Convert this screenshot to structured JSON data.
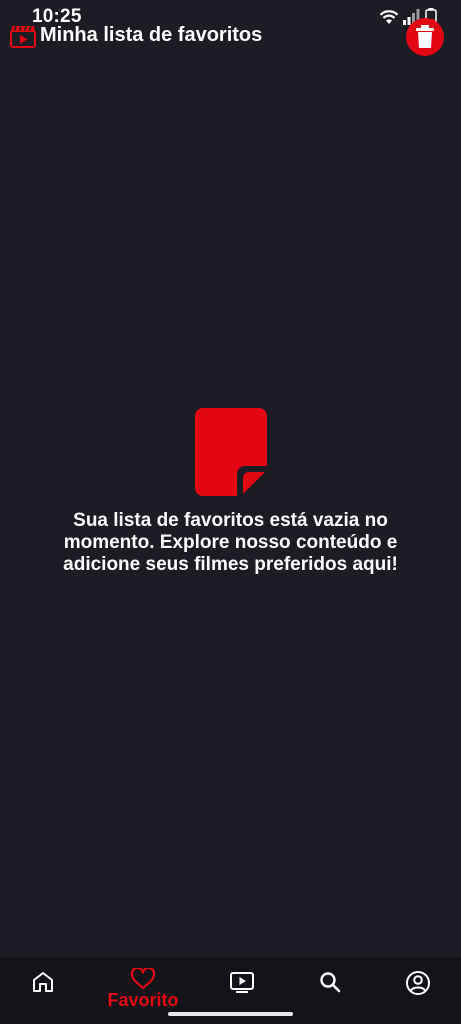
{
  "status_bar": {
    "time": "10:25",
    "icons": [
      "wifi-icon",
      "signal-icon",
      "battery-icon"
    ]
  },
  "header": {
    "title": "Minha lista de favoritos",
    "leading_icon": "clapperboard-icon",
    "action_icon": "trash-icon"
  },
  "empty_state": {
    "icon": "document-icon",
    "message": "Sua lista de favoritos está vazia no momento. Explore nosso conteúdo e adicione seus filmes preferidos aqui!"
  },
  "bottom_nav": {
    "items": [
      {
        "icon": "home-icon",
        "label": ""
      },
      {
        "icon": "heart-icon",
        "label": "Favorito",
        "active": true
      },
      {
        "icon": "play-icon",
        "label": ""
      },
      {
        "icon": "search-icon",
        "label": ""
      },
      {
        "icon": "profile-icon",
        "label": ""
      }
    ]
  },
  "colors": {
    "background": "#1b1c24",
    "nav_background": "#13141a",
    "accent": "#e30613",
    "text": "#ffffff"
  }
}
